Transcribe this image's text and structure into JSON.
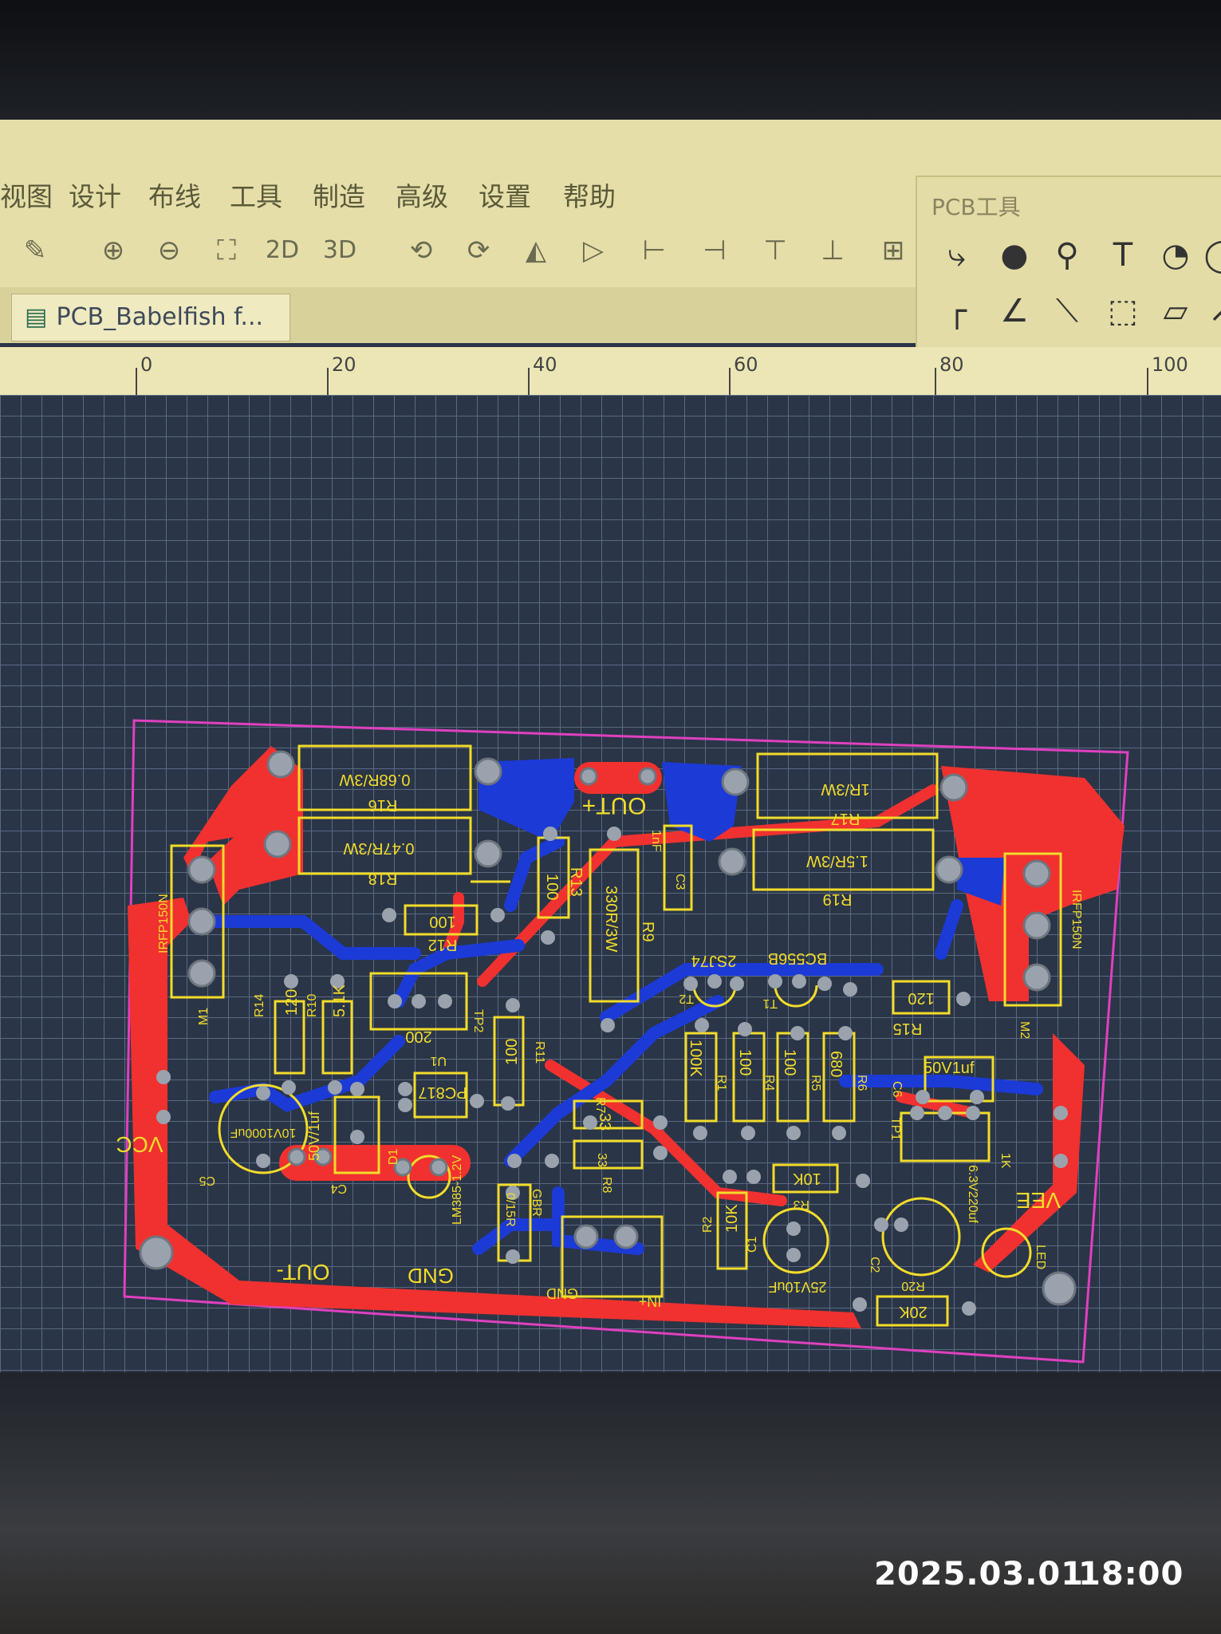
{
  "menu": {
    "items": [
      "视图",
      "设计",
      "布线",
      "工具",
      "制造",
      "高级",
      "设置",
      "帮助"
    ]
  },
  "toolbar": {
    "btn_2d": "2D",
    "btn_3d": "3D"
  },
  "tab": {
    "label": "PCB_Babelfish f..."
  },
  "pcb_tools": {
    "title": "PCB工具"
  },
  "ruler": {
    "ticks": [
      "0",
      "20",
      "40",
      "60",
      "80",
      "100"
    ]
  },
  "board": {
    "labels": {
      "r16_val": "0.68R/3W",
      "r16": "R16",
      "r18_val": "0.47R/3W",
      "r18": "R18",
      "out_plus": "OUT+",
      "r17_val": "1R/3W",
      "r17": "R17",
      "r19_val": "1.5R/3W",
      "r19": "R19",
      "c3": "C3",
      "c3_val": "1nF",
      "r13": "R13",
      "r13_val": "100",
      "r9_val": "330R/3W",
      "r9": "R9",
      "m1": "M1",
      "m1_val": "IRFP150N",
      "m2": "M2",
      "m2_val": "IRFP150N",
      "r12_val": "100",
      "r12": "R12",
      "t2_val": "2SJ74",
      "t2": "T2",
      "t1_val": "BC556B",
      "t1": "T1",
      "r15_val": "120",
      "r15": "R15",
      "tp2": "TP2",
      "r_200": "200",
      "r14": "R14",
      "r14_val": "120",
      "r10": "R10",
      "r10_val": "5.1K",
      "r11_val": "100",
      "r11": "R11",
      "u1": "U1",
      "u1_val": "PC817",
      "r1_val": "100K",
      "r1": "R1",
      "r4_val": "100",
      "r4": "R4",
      "r5_val": "100",
      "r5": "R5",
      "r6_val": "680",
      "r6": "R6",
      "c6": "C6",
      "c6_val": "50V1uf",
      "vcc": "VCC",
      "c5": "C5",
      "c5_val": "10V1000uF",
      "c4_val": "50V/1uf",
      "c4": "C4",
      "d1": "D1",
      "lm385": "LM385-1.2V",
      "r7": "R7",
      "r7_val": "33",
      "r8": "R8",
      "r8_val": "33",
      "tp1": "TP1",
      "r_1k": "1K",
      "vee": "VEE",
      "r3_val": "10K",
      "r3": "R3",
      "r_015": "0/15R",
      "gbr": "GBR",
      "r2": "R2",
      "r2_val": "10K",
      "c1": "C1",
      "c2": "C2",
      "c2_val": "6.3V220uf",
      "led": "LED",
      "out_minus": "OUT-",
      "gnd": "GND",
      "gnd_in": "GND",
      "in_plus": "IN+",
      "c1_val": "25V10uF",
      "r20": "R20",
      "r20_val": "20K"
    }
  },
  "photo_stamp": {
    "date": "2025.03.01",
    "time": "18:00"
  },
  "colors": {
    "toolbar_bg": "#e6dea8",
    "canvas_bg": "#2a3547",
    "grid": "#5a6a82",
    "top_copper": "#f0312f",
    "bottom_copper": "#1c3ad6",
    "silkscreen": "#f2dc2a",
    "board_outline": "#e040c0"
  }
}
